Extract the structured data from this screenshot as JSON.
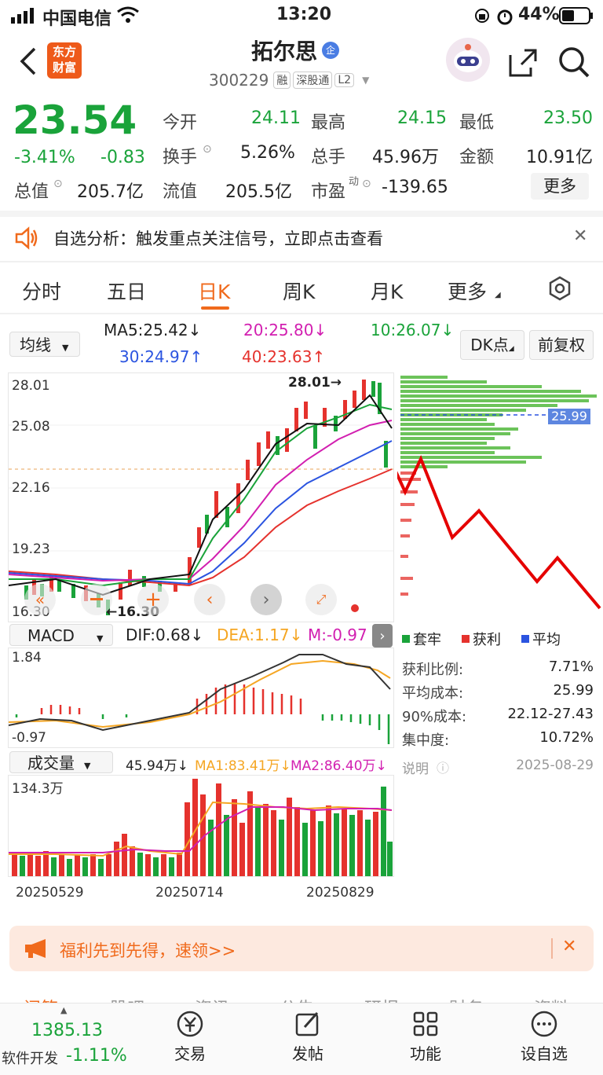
{
  "status_bar": {
    "carrier": "中国电信",
    "time": "13:20",
    "battery": "44%"
  },
  "header": {
    "logo_line1": "东方",
    "logo_line2": "财富",
    "stock_name": "拓尔思",
    "badge": "企",
    "code": "300229",
    "tags": [
      "融",
      "深股通",
      "L2"
    ]
  },
  "quote": {
    "price": "23.54",
    "change_pct": "-3.41%",
    "change": "-0.83",
    "open_label": "今开",
    "open": "24.11",
    "high_label": "最高",
    "high": "24.15",
    "low_label": "最低",
    "low": "23.50",
    "turnover_label": "换手",
    "turnover": "5.26%",
    "volume_label": "总手",
    "volume": "45.96万",
    "amount_label": "金额",
    "amount": "10.91亿",
    "mktcap_label": "总值",
    "mktcap": "205.7亿",
    "float_label": "流值",
    "float_cap": "205.5亿",
    "pe_label": "市盈",
    "pe_sup": "动",
    "pe": "-139.65",
    "more_btn": "更多"
  },
  "notice": {
    "text": "自选分析：触发重点关注信号，立即点击查看"
  },
  "tabs": {
    "items": [
      "分时",
      "五日",
      "日K",
      "周K",
      "月K",
      "更多"
    ],
    "active": "日K"
  },
  "ma": {
    "selector": "均线",
    "ma5": "MA5:25.42↓",
    "ma20": "20:25.80↓",
    "ma10": "10:26.07↓",
    "ma30": "30:24.97↑",
    "ma40": "40:23.63↑",
    "dk": "DK点",
    "adjust": "前复权"
  },
  "kline": {
    "y_labels": [
      "28.01",
      "25.08",
      "22.16",
      "19.23",
      "16.30"
    ],
    "high_mark": "28.01→",
    "low_mark": "←16.30",
    "cost_price": "25.99"
  },
  "macd": {
    "selector": "MACD",
    "dif": "DIF:0.68↓",
    "dea": "DEA:1.17↓",
    "m": "M:-0.97",
    "y_top": "1.84",
    "y_bottom": "-0.97"
  },
  "volume": {
    "selector": "成交量",
    "vol": "45.94万↓",
    "ma1": "MA1:83.41万↓",
    "ma2": "MA2:86.40万↓",
    "y_top": "134.3万",
    "dates": [
      "20250529",
      "20250714",
      "20250829"
    ]
  },
  "chip": {
    "legend": [
      "套牢",
      "获利",
      "平均"
    ],
    "rows": [
      [
        "获利比例:",
        "7.71%"
      ],
      [
        "平均成本:",
        "25.99"
      ],
      [
        "90%成本:",
        "22.12-27.43"
      ],
      [
        "集中度:",
        "10.72%"
      ]
    ],
    "note": "说明",
    "date": "2025-08-29"
  },
  "promo": {
    "text": "福利先到先得，速领>>"
  },
  "bottom": {
    "index_value": "1385.13",
    "index_name": "软件开发",
    "index_change": "-1.11%",
    "items": [
      "交易",
      "发帖",
      "功能",
      "设自选"
    ],
    "peek": [
      "问答",
      "股吧",
      "资讯",
      "公告",
      "研报",
      "财务",
      "资料"
    ]
  },
  "colors": {
    "up": "#e5322d",
    "down": "#1aa33a",
    "accent": "#f06a1c",
    "ma30": "#2b54e0"
  }
}
